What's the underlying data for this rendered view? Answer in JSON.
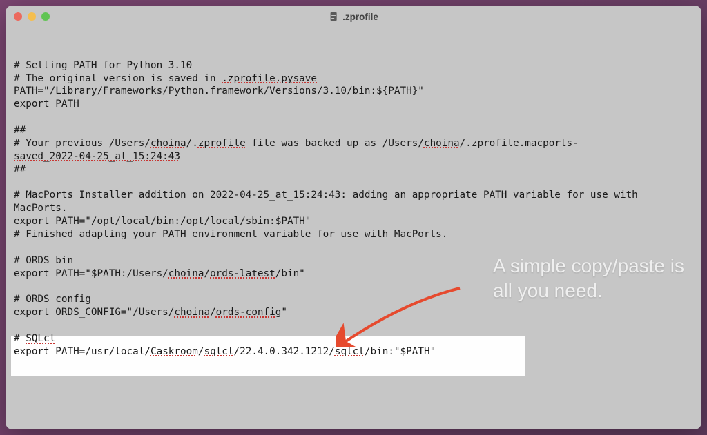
{
  "window": {
    "title": ".zprofile"
  },
  "annotation": {
    "line1": "A simple copy/paste is",
    "line2": "all you need."
  },
  "file": {
    "lines": [
      {
        "type": "plain",
        "text": "# Setting PATH for Python 3.10"
      },
      {
        "type": "spelled",
        "segments": [
          {
            "t": "# The original version is saved in ",
            "s": false
          },
          {
            "t": ".zprofile.pysave",
            "s": true
          }
        ]
      },
      {
        "type": "plain",
        "text": "PATH=\"/Library/Frameworks/Python.framework/Versions/3.10/bin:${PATH}\""
      },
      {
        "type": "plain",
        "text": "export PATH"
      },
      {
        "type": "blank"
      },
      {
        "type": "plain",
        "text": "##"
      },
      {
        "type": "spelled",
        "segments": [
          {
            "t": "# Your previous /Users/",
            "s": false
          },
          {
            "t": "choina",
            "s": true
          },
          {
            "t": "/.",
            "s": false
          },
          {
            "t": "zprofile",
            "s": true
          },
          {
            "t": " file was backed up as /Users/",
            "s": false
          },
          {
            "t": "choina",
            "s": true
          },
          {
            "t": "/.zprofile.macports-",
            "s": false
          }
        ]
      },
      {
        "type": "spelled",
        "segments": [
          {
            "t": "saved_2022-04-25_at_15:24:43",
            "s": true
          }
        ]
      },
      {
        "type": "plain",
        "text": "##"
      },
      {
        "type": "blank"
      },
      {
        "type": "plain",
        "text": "# MacPorts Installer addition on 2022-04-25_at_15:24:43: adding an appropriate PATH variable for use with MacPorts."
      },
      {
        "type": "plain",
        "text": "export PATH=\"/opt/local/bin:/opt/local/sbin:$PATH\""
      },
      {
        "type": "plain",
        "text": "# Finished adapting your PATH environment variable for use with MacPorts."
      },
      {
        "type": "blank"
      },
      {
        "type": "plain",
        "text": "# ORDS bin"
      },
      {
        "type": "spelled",
        "segments": [
          {
            "t": "export PATH=\"$PATH:/Users/",
            "s": false
          },
          {
            "t": "choina",
            "s": true
          },
          {
            "t": "/",
            "s": false
          },
          {
            "t": "ords-latest",
            "s": true
          },
          {
            "t": "/bin\"",
            "s": false
          }
        ]
      },
      {
        "type": "blank"
      },
      {
        "type": "plain",
        "text": "# ORDS config"
      },
      {
        "type": "spelled",
        "segments": [
          {
            "t": "export ORDS_CONFIG=\"/Users/",
            "s": false
          },
          {
            "t": "choina",
            "s": true
          },
          {
            "t": "/",
            "s": false
          },
          {
            "t": "ords-config",
            "s": true
          },
          {
            "t": "\"",
            "s": false
          }
        ]
      },
      {
        "type": "blank"
      },
      {
        "type": "spelled",
        "segments": [
          {
            "t": "# ",
            "s": false
          },
          {
            "t": "SQLcl",
            "s": true
          }
        ]
      },
      {
        "type": "spelled",
        "segments": [
          {
            "t": "export PATH=/usr/local/",
            "s": false
          },
          {
            "t": "Caskroom",
            "s": true
          },
          {
            "t": "/",
            "s": false
          },
          {
            "t": "sqlcl",
            "s": true
          },
          {
            "t": "/22.4.0.342.1212/",
            "s": false
          },
          {
            "t": "sqlcl",
            "s": true
          },
          {
            "t": "/bin:\"$PATH\"",
            "s": false
          }
        ]
      }
    ]
  }
}
